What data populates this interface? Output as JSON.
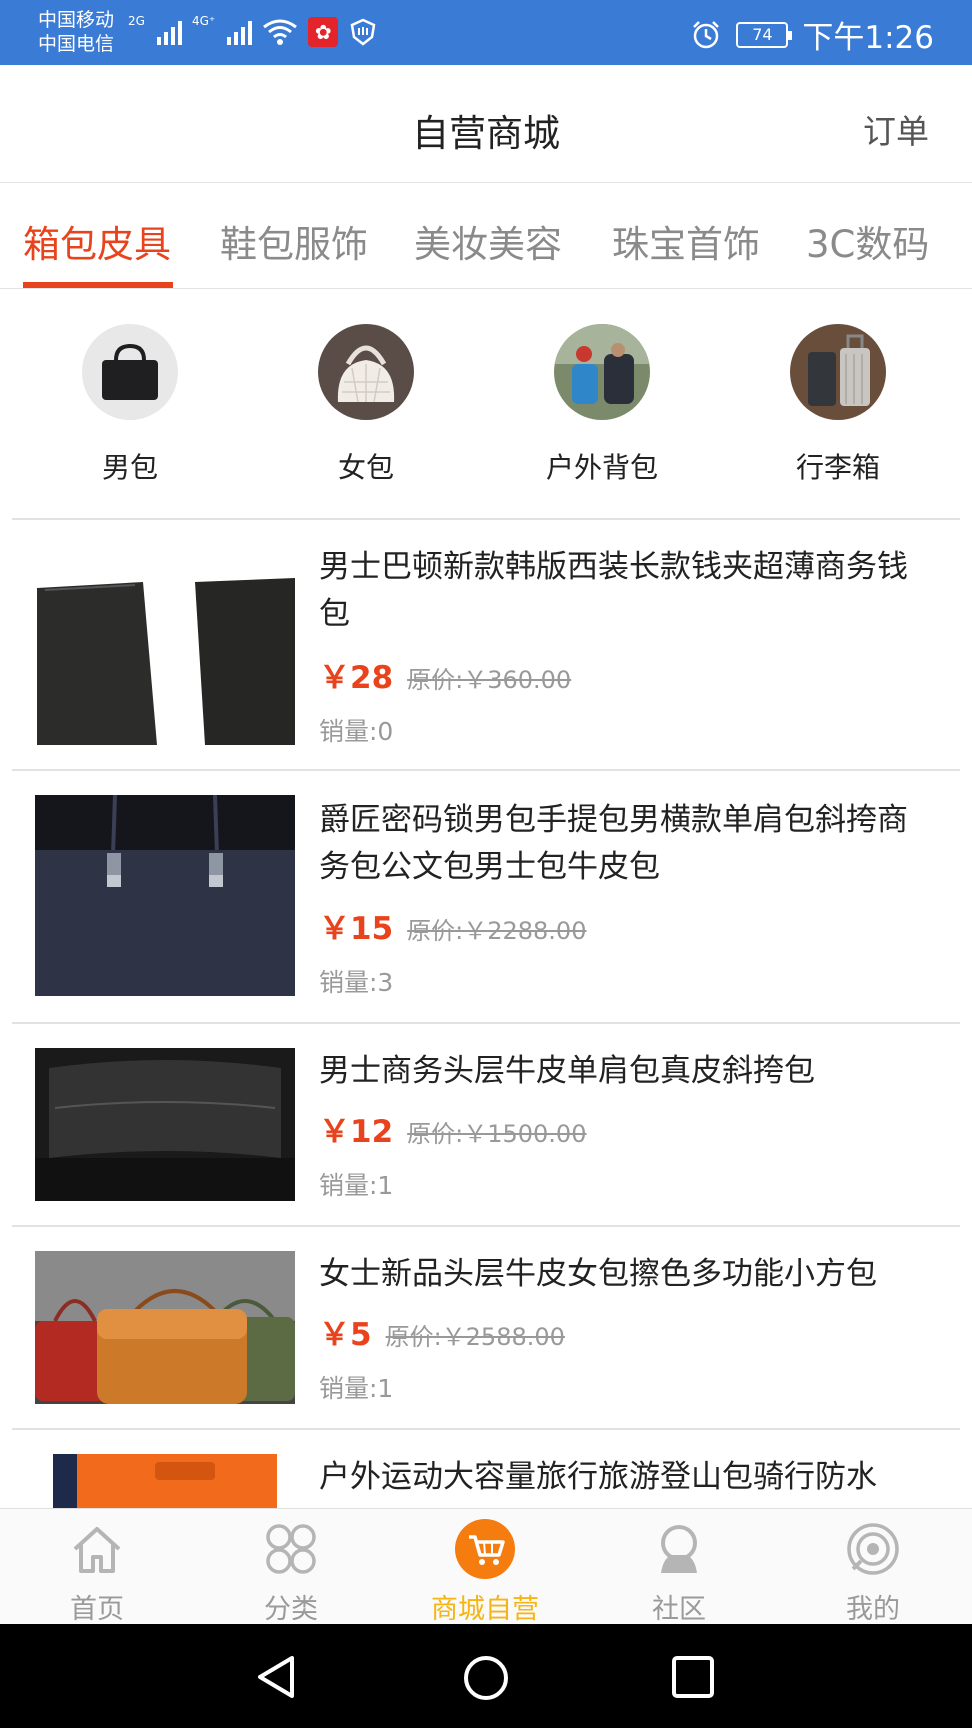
{
  "status_bar": {
    "carrier_1": "中国移动",
    "carrier_2": "中国电信",
    "net_1": "2G",
    "net_2": "4G⁺",
    "battery": "74",
    "time": "下午1:26"
  },
  "header": {
    "title": "自营商城",
    "orders_label": "订单"
  },
  "tabs": [
    {
      "label": "箱包皮具",
      "active": true
    },
    {
      "label": "鞋包服饰",
      "active": false
    },
    {
      "label": "美妆美容",
      "active": false
    },
    {
      "label": "珠宝首饰",
      "active": false
    },
    {
      "label": "3C数码",
      "active": false
    }
  ],
  "categories": [
    {
      "label": "男包",
      "icon": "mens-bag-photo"
    },
    {
      "label": "女包",
      "icon": "womens-bag-photo"
    },
    {
      "label": "户外背包",
      "icon": "backpack-photo"
    },
    {
      "label": "行李箱",
      "icon": "luggage-photo"
    }
  ],
  "products": [
    {
      "title": "男士巴顿新款韩版西装长款钱夹超薄商务钱包",
      "price": "￥28",
      "original_price": "原价:￥360.00",
      "sales": "销量:0",
      "image": "black-wallet-photo"
    },
    {
      "title": "爵匠密码锁男包手提包男横款单肩包斜挎商务包公文包男士包牛皮包",
      "price": "￥15",
      "original_price": "原价:￥2288.00",
      "sales": "销量:3",
      "image": "navy-briefcase-photo"
    },
    {
      "title": "男士商务头层牛皮单肩包真皮斜挎包",
      "price": "￥12",
      "original_price": "原价:￥1500.00",
      "sales": "销量:1",
      "image": "black-leather-bag-photo"
    },
    {
      "title": "女士新品头层牛皮女包擦色多功能小方包",
      "price": "￥5",
      "original_price": "原价:￥2588.00",
      "sales": "销量:1",
      "image": "color-handbags-photo"
    },
    {
      "title": "户外运动大容量旅行旅游登山包骑行防水",
      "price": "",
      "original_price": "",
      "sales": "",
      "image": "orange-backpack-photo"
    }
  ],
  "bottom_nav": [
    {
      "label": "首页",
      "icon": "home-icon",
      "active": false
    },
    {
      "label": "分类",
      "icon": "category-icon",
      "active": false
    },
    {
      "label": "商城自营",
      "icon": "cart-icon",
      "active": true
    },
    {
      "label": "社区",
      "icon": "community-icon",
      "active": false
    },
    {
      "label": "我的",
      "icon": "profile-icon",
      "active": false
    }
  ],
  "colors": {
    "status_bar": "#3a7bd5",
    "accent": "#e8431c",
    "nav_active": "#f5b515",
    "muted": "#999999"
  }
}
